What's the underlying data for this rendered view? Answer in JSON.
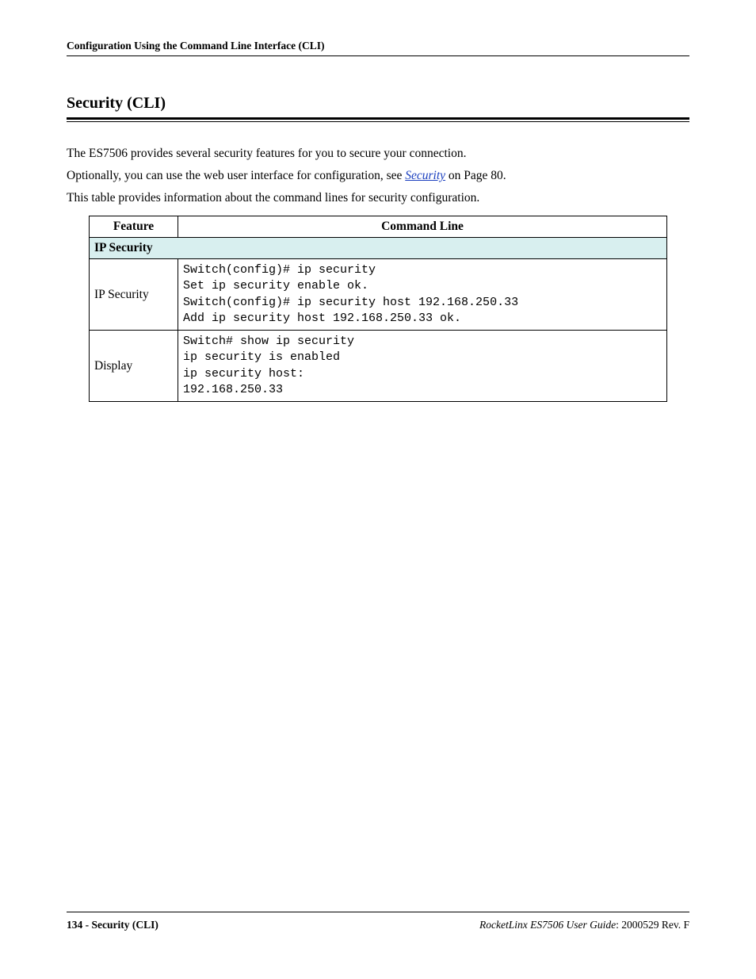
{
  "header": {
    "running": "Configuration Using the Command Line Interface (CLI)"
  },
  "title": "Security (CLI)",
  "paragraphs": {
    "p1": "The ES7506 provides several security features for you to secure your connection.",
    "p2_pre": "Optionally, you can use the web user interface for configuration, see ",
    "p2_link": "Security",
    "p2_post": " on Page 80.",
    "p3": "This table provides information about the command lines for security configuration."
  },
  "table": {
    "headers": {
      "feature": "Feature",
      "cmd": "Command Line"
    },
    "section": "IP Security",
    "rows": [
      {
        "feature": "IP Security",
        "code": "Switch(config)# ip security\nSet ip security enable ok.\nSwitch(config)# ip security host 192.168.250.33\nAdd ip security host 192.168.250.33 ok."
      },
      {
        "feature": "Display",
        "code": "Switch# show ip security\nip security is enabled\nip security host:\n192.168.250.33"
      }
    ]
  },
  "footer": {
    "left": "134 - Security (CLI)",
    "right_ital": "RocketLinx ES7506  User Guide",
    "right_rest": ": 2000529 Rev. F"
  }
}
